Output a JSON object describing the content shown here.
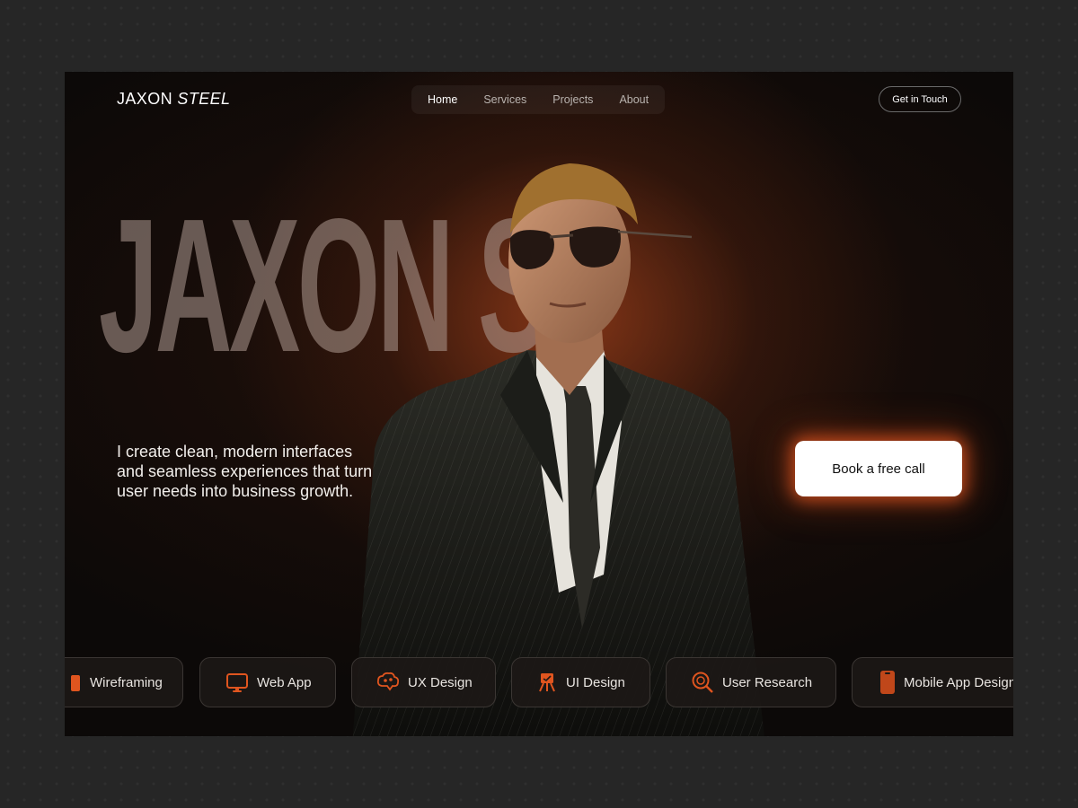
{
  "header": {
    "logo_first": "JAXON",
    "logo_second": "STEEL",
    "nav": [
      "Home",
      "Services",
      "Projects",
      "About"
    ],
    "active_nav": "Home",
    "contact_button": "Get in Touch"
  },
  "hero": {
    "big_name": "JAXON STEEL",
    "tagline": "I create clean, modern interfaces and seamless experiences that turn user needs into business growth.",
    "cta_label": "Book a free call"
  },
  "skills": [
    {
      "label": "Wireframing",
      "icon": "wireframe-icon"
    },
    {
      "label": "Web App",
      "icon": "monitor-icon"
    },
    {
      "label": "UX Design",
      "icon": "brain-icon"
    },
    {
      "label": "UI Design",
      "icon": "easel-icon"
    },
    {
      "label": "User Research",
      "icon": "magnifier-icon"
    },
    {
      "label": "Mobile App Design",
      "icon": "mobile-icon"
    }
  ],
  "colors": {
    "accent": "#e0551f",
    "background": "#0c0908",
    "page": "#262626"
  }
}
